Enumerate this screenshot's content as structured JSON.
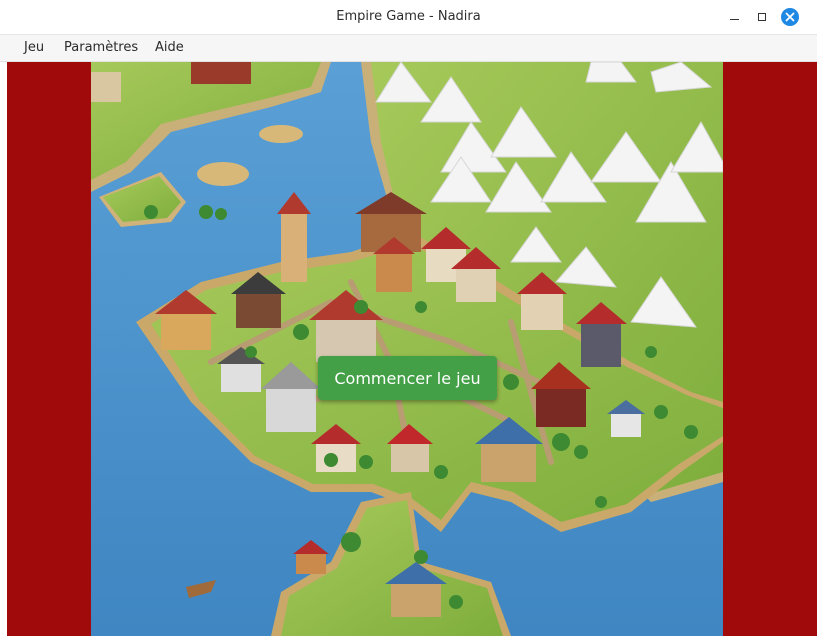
{
  "window": {
    "title": "Empire Game - Nadira"
  },
  "menubar": {
    "items": [
      {
        "label": "Jeu"
      },
      {
        "label": "Paramètres"
      },
      {
        "label": "Aide"
      }
    ]
  },
  "game": {
    "start_button_label": "Commencer le jeu",
    "colors": {
      "border": "#a00a0a",
      "button": "#43a047",
      "water": "#4a90c8",
      "land": "#8fbf4a",
      "mountain": "#f2f2f2"
    },
    "map_image": "isometric-medieval-town-map"
  }
}
